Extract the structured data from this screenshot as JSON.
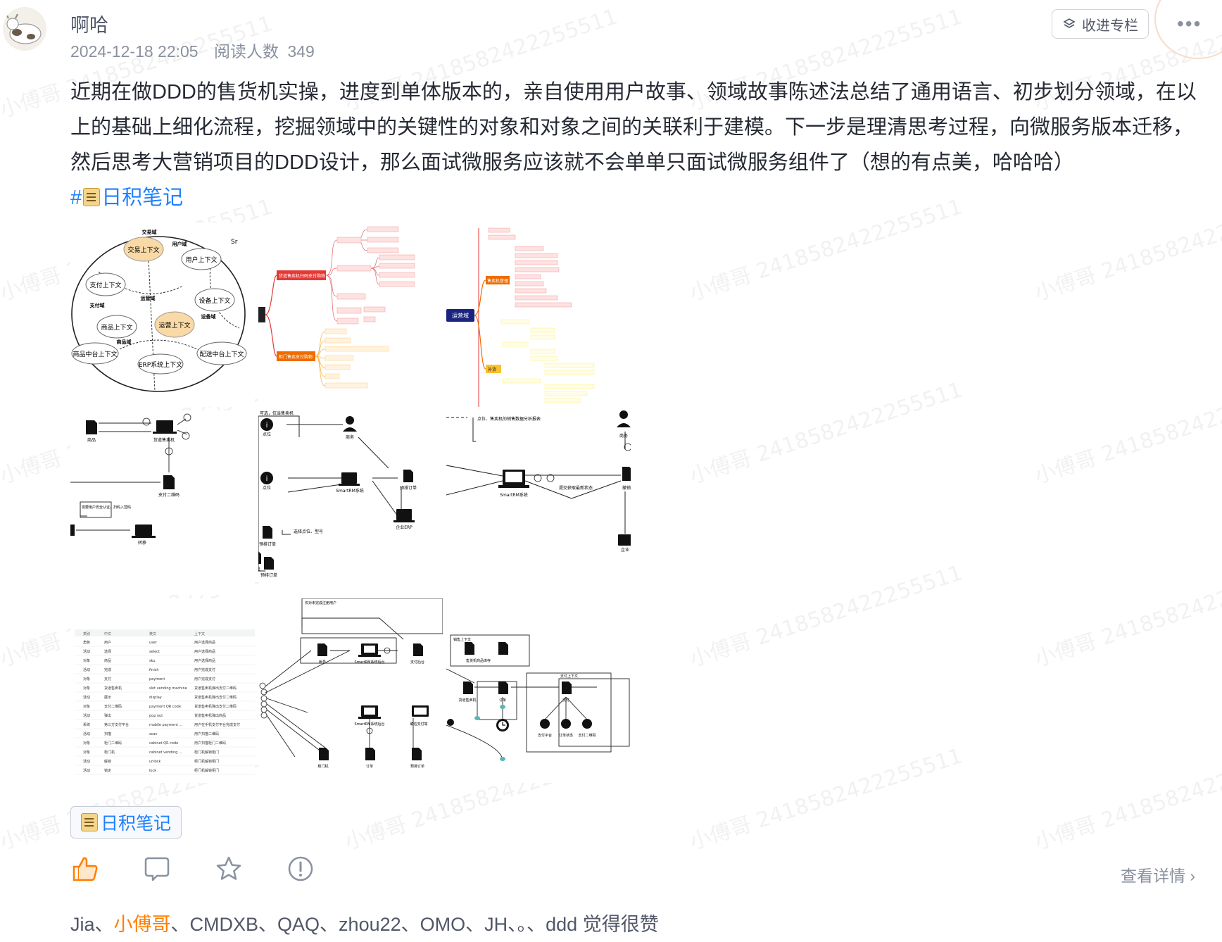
{
  "post": {
    "author": "啊哈",
    "datetime": "2024-12-18 22:05",
    "reads_label": "阅读人数",
    "reads_count": "349",
    "collect_label": "收进专栏",
    "more_icon": "more-dots-icon",
    "content_text": "近期在做DDD的售货机实操，进度到单体版本的，亲自使用用户故事、领域故事陈述法总结了通用语言、初步划分领域，在以上的基础上细化流程，挖掘领域中的关键性的对象和对象之间的关联利于建模。下一步是理清思考过程，向微服务版本迁移，然后思考大营销项目的DDD设计，那么面试微服务应该就不会单单只面试微服务组件了（想的有点美，哈哈哈）",
    "topic_hash": "#",
    "topic_label": "日积笔记",
    "tag_label": "日积笔记",
    "view_detail": "查看详情",
    "likers": [
      "Jia",
      "小傅哥",
      "CMDXB",
      "QAQ",
      "zhou22",
      "OMO",
      "JH",
      "。",
      "ddd"
    ],
    "likers_suffix": " 觉得很赞",
    "highlight_color": "#ff7d00",
    "topic_color": "#1e80ff"
  },
  "watermark": "小傅哥 2418582422255511",
  "images": {
    "img1": {
      "contexts": [
        "交易上下文",
        "用户上下文",
        "支付上下文",
        "设备上下文",
        "商品上下文",
        "运营上下文",
        "商品中台上下文",
        "ERP系统上下文",
        "配送中台上下文"
      ],
      "domains": [
        "交易域",
        "用户域",
        "支付域",
        "运营域",
        "设备域",
        "商品域"
      ],
      "corner": "Sr"
    },
    "img2": {
      "root": "",
      "branch_a": "货道售卖机扫码支付购物",
      "branch_b": "柜门售卖支付购物"
    },
    "img3": {
      "root": "运营域",
      "branch_a": "售卖机管理",
      "branch_b": "补货"
    },
    "img4": {
      "nodes": [
        "商品",
        "货道售卖机",
        "支付二维码",
        "转移"
      ],
      "note": "需要用户安全认证，扫码入营码"
    },
    "img5": {
      "nodes": [
        "点位",
        "商务",
        "点位",
        "SmartRM系统",
        "预排订单",
        "企业ERP",
        "预排订单",
        "订单",
        "预排订单"
      ],
      "note": "可选，仅当售卖机",
      "extra": "选择点位、型号"
    },
    "img6": {
      "nodes": [
        "商务",
        "SmartRM系统",
        "撤销",
        "企业"
      ],
      "note": "点位、售卖机的销售数据分析报表",
      "edge": "提交获取最新状态"
    },
    "img7": {
      "headers": [
        "类别",
        "中文",
        "英文",
        "上下文"
      ],
      "rows": [
        [
          "角色",
          "用户",
          "user",
          "用户选择商品"
        ],
        [
          "活动",
          "选择",
          "select",
          "用户选择商品"
        ],
        [
          "对象",
          "商品",
          "sku",
          "用户选择商品"
        ],
        [
          "活动",
          "完成",
          "finish",
          "用户完成支付"
        ],
        [
          "对象",
          "支付",
          "payment",
          "用户完成支付"
        ],
        [
          "对象",
          "货道售卖机",
          "slot vending machine",
          "货道售卖机弹出支付二维码"
        ],
        [
          "活动",
          "展示",
          "display",
          "货道售卖机弹出支付二维码"
        ],
        [
          "对象",
          "支付二维码",
          "payment QR code",
          "货道售卖机弹出支付二维码"
        ],
        [
          "活动",
          "弹出",
          "pop out",
          "货道售卖机弹出商品"
        ],
        [
          "系统",
          "第三方支付平台",
          "mobile payment ...",
          "用户在手机支付平台完成支付"
        ],
        [
          "活动",
          "扫描",
          "scan",
          "用户扫描二维码"
        ],
        [
          "对象",
          "柜门二维码",
          "cabinet QR code",
          "用户扫描柜门二维码"
        ],
        [
          "对象",
          "柜门机",
          "cabinet vending ...",
          "柜门机解锁柜门"
        ],
        [
          "活动",
          "解锁",
          "unlock",
          "柜门机解锁柜门"
        ],
        [
          "活动",
          "锁定",
          "lock",
          "柜门机解锁柜门"
        ]
      ]
    },
    "img8": {
      "nodes": [
        "账号",
        "SmartRM系统后台",
        "支付后台",
        "SmartRM系统后台",
        "确信支付等",
        "订单",
        "预排订单",
        "柜门机"
      ],
      "note": "仅对未完成注册用户"
    },
    "img9": {
      "nodes": [
        "售货机商品库存",
        "货道售卖机",
        "订单",
        "支付",
        "支付平台",
        "订单状态",
        "支付二维码"
      ],
      "contexts": [
        "销售上下文",
        "支付上下文"
      ]
    }
  }
}
